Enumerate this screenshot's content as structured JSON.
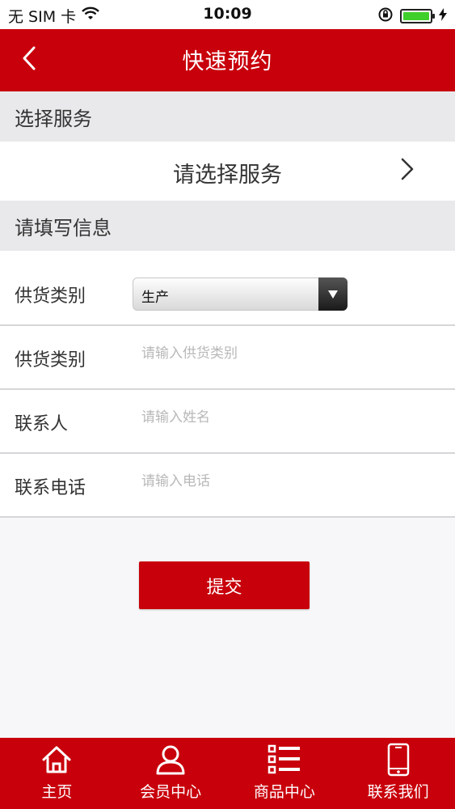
{
  "status_bar": {
    "carrier": "无 SIM 卡",
    "time": "10:09",
    "battery_percent": 100
  },
  "nav": {
    "title": "快速预约",
    "back_icon": "chevron-left-icon"
  },
  "sections": {
    "service_header": "选择服务",
    "service_select": "请选择服务",
    "info_header": "请填写信息"
  },
  "form": {
    "supply_type_select": {
      "label": "供货类别",
      "value": "生产"
    },
    "supply_type_input": {
      "label": "供货类别",
      "placeholder": "请输入供货类别"
    },
    "contact_name": {
      "label": "联系人",
      "placeholder": "请输入姓名"
    },
    "contact_phone": {
      "label": "联系电话",
      "placeholder": "请输入电话"
    },
    "submit_label": "提交"
  },
  "tab_bar": {
    "items": [
      {
        "label": "主页",
        "icon": "home-icon"
      },
      {
        "label": "会员中心",
        "icon": "user-icon"
      },
      {
        "label": "商品中心",
        "icon": "list-icon"
      },
      {
        "label": "联系我们",
        "icon": "phone-icon"
      }
    ]
  },
  "colors": {
    "brand_red": "#c8000b",
    "section_bg": "#e9e9eb",
    "placeholder": "#b8b8b8"
  }
}
